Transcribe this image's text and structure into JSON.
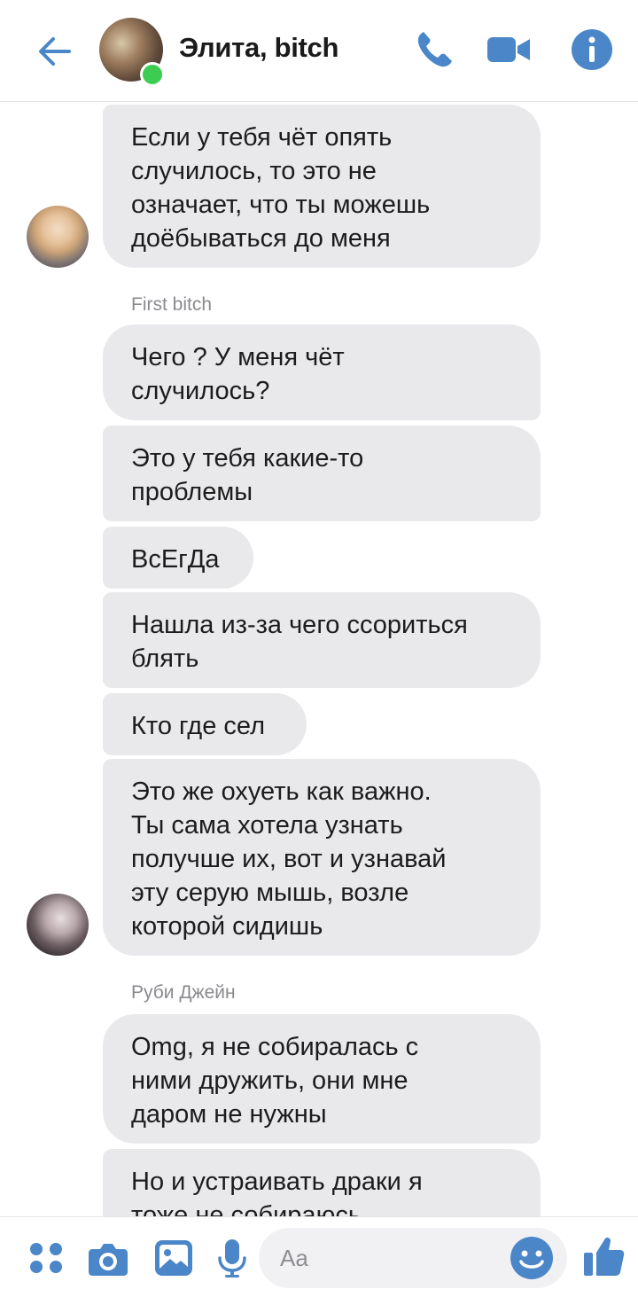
{
  "header": {
    "title": "Элита, bitch",
    "icons": [
      "back-arrow-icon",
      "phone-icon",
      "video-camera-icon",
      "info-icon"
    ],
    "accent": "#4a86c8",
    "online_color": "#3ccc52"
  },
  "messages": [
    {
      "text": "Если у тебя чёт опять\nслучилось, то это не\nозначает, что ты можешь\nдоёбываться до меня"
    },
    {
      "sender": "First bitch"
    },
    {
      "text": "Чего ? У меня чёт\nслучилось?"
    },
    {
      "text": "Это у тебя какие-то\nпроблемы"
    },
    {
      "text": "ВсЕгДа"
    },
    {
      "text": "Нашла из-за чего ссориться\nблять"
    },
    {
      "text": "Кто где сел"
    },
    {
      "text": "Это же охуеть как важно.\nТы сама хотела узнать\nполучше их, вот и узнавай\nэту серую мышь, возле\nкоторой сидишь"
    },
    {
      "sender": "Руби Джейн"
    },
    {
      "text": "Omg, я не собиралась с\nними дружить, они мне\nдаром не нужны"
    },
    {
      "text": "Но и устраивать драки я\nтоже не собираюсь"
    }
  ],
  "composer": {
    "placeholder": "Aa",
    "icons": [
      "apps-grid-icon",
      "camera-icon",
      "gallery-icon",
      "microphone-icon",
      "emoji-icon",
      "thumbs-up-icon"
    ]
  },
  "colors": {
    "bubble_bg": "#e9e9ec",
    "text": "#1c1c1c",
    "sender": "#8a8a8f"
  }
}
